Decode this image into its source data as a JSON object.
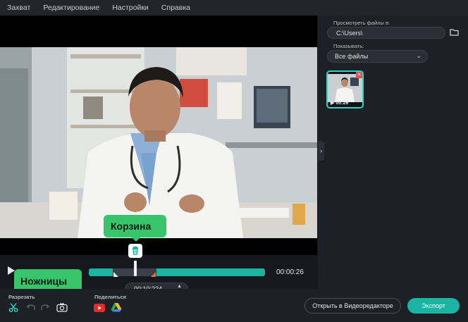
{
  "menu": [
    "Захват",
    "Редактирование",
    "Настройки",
    "Справка"
  ],
  "sidebar": {
    "browse_label": "Просмотреть файлы в:",
    "path_value": "C:\\Users\\",
    "show_label": "Показывать:",
    "filter_value": "Все файлы",
    "thumbnail": {
      "duration": "00:26"
    }
  },
  "timeline": {
    "total_time": "00:00:26",
    "current_time": "00:10:224"
  },
  "callouts": {
    "trash": "Корзина",
    "scissors": "Ножницы"
  },
  "toolbar": {
    "cut_label": "Разрезать",
    "share_label": "Поделиться",
    "open_editor_label": "Открыть в Видеоредакторе",
    "export_label": "Экспорт"
  },
  "icons": {
    "scissors": "scissors-icon",
    "undo": "undo-icon",
    "redo": "redo-icon",
    "camera": "camera-icon",
    "youtube": "youtube-icon",
    "drive": "google-drive-icon",
    "trash": "trash-icon",
    "folder": "folder-icon"
  },
  "colors": {
    "accent": "#1bb3a2",
    "callout": "#37c46a",
    "close": "#e94b4b"
  }
}
